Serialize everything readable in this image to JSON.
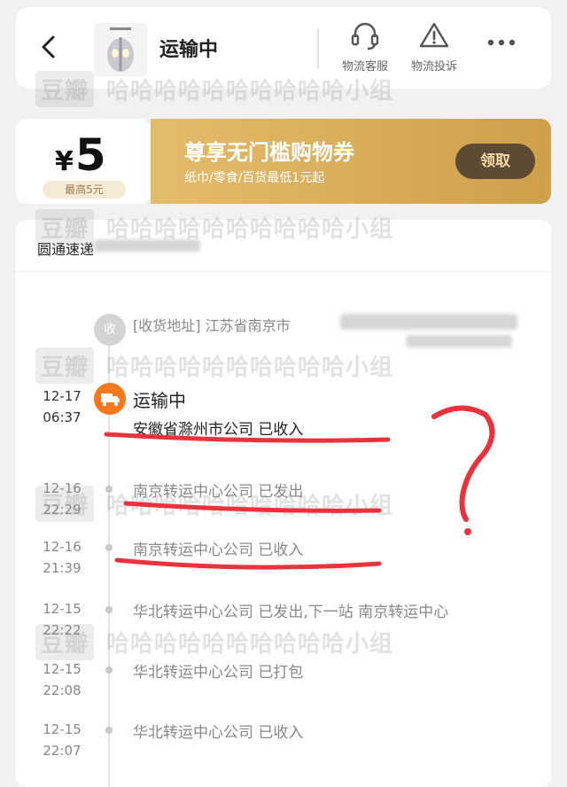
{
  "header": {
    "title": "运输中",
    "service_label": "物流客服",
    "complaint_label": "物流投诉"
  },
  "coupon": {
    "currency": "¥",
    "amount": "5",
    "max_label": "最高5元",
    "title": "尊享无门槛购物券",
    "subtitle": "纸巾/零食/百货最低1元起",
    "claim_label": "领取"
  },
  "tracking": {
    "carrier": "圆通速递",
    "receiver_badge": "收",
    "address": "[收货地址] 江苏省南京市",
    "current": {
      "date": "12-17",
      "time": "06:37",
      "status": "运输中",
      "detail": "安徽省滁州市公司 已收入"
    },
    "events": [
      {
        "date": "12-16",
        "time": "22:29",
        "text": "南京转运中心公司 已发出"
      },
      {
        "date": "12-16",
        "time": "21:39",
        "text": "南京转运中心公司 已收入"
      },
      {
        "date": "12-15",
        "time": "22:22",
        "text": "华北转运中心公司 已发出,下一站 南京转运中心"
      },
      {
        "date": "12-15",
        "time": "22:08",
        "text": "华北转运中心公司 已打包"
      },
      {
        "date": "12-15",
        "time": "22:07",
        "text": "华北转运中心公司 已收入"
      }
    ]
  },
  "watermark": {
    "logo": "豆瓣",
    "text": "哈哈哈哈哈哈哈哈哈哈小组"
  },
  "colors": {
    "accent_orange": "#f7771e",
    "coupon_gold": "#e3bc6b",
    "annotation_red": "#e8323c"
  }
}
